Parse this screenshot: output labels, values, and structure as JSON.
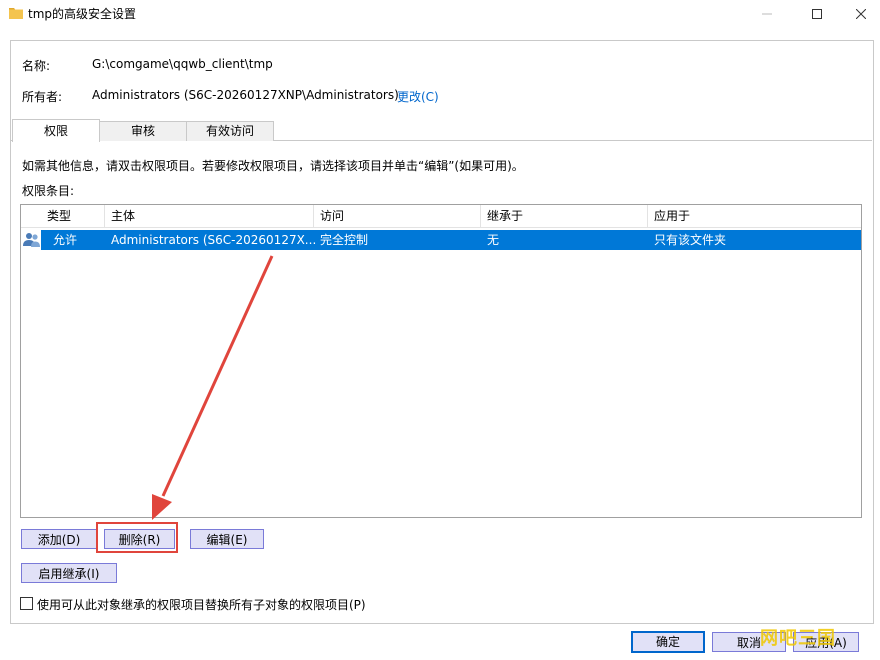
{
  "window": {
    "title": "tmp的高级安全设置",
    "minimize_icon": "minimize-icon",
    "maximize_icon": "maximize-icon",
    "close_icon": "close-icon"
  },
  "info": {
    "name_label": "名称:",
    "name_value": "G:\\comgame\\qqwb_client\\tmp",
    "owner_label": "所有者:",
    "owner_value": "Administrators (S6C-20260127XNP\\Administrators)",
    "change_link": "更改(C)"
  },
  "tabs": [
    {
      "label": "权限",
      "active": true
    },
    {
      "label": "审核",
      "active": false
    },
    {
      "label": "有效访问",
      "active": false
    }
  ],
  "hint": "如需其他信息，请双击权限项目。若要修改权限项目，请选择该项目并单击“编辑”(如果可用)。",
  "entries_label": "权限条目:",
  "table": {
    "columns": [
      "类型",
      "主体",
      "访问",
      "继承于",
      "应用于"
    ],
    "rows": [
      {
        "icon": "users-icon",
        "selected": true,
        "cells": [
          "允许",
          "Administrators (S6C-20260127X...",
          "完全控制",
          "无",
          "只有该文件夹"
        ]
      }
    ]
  },
  "buttons": {
    "add": "添加(D)",
    "remove": "删除(R)",
    "edit": "编辑(E)",
    "enable_inheritance": "启用继承(I)"
  },
  "replace_checkbox": {
    "label": "使用可从此对象继承的权限项目替换所有子对象的权限项目(P)",
    "checked": false
  },
  "footer": {
    "ok": "确定",
    "cancel": "取消",
    "apply": "应用(A)"
  },
  "watermark": "网吧三国",
  "colors": {
    "selection": "#0078d7",
    "button_border": "#7a7ad8",
    "button_bg": "#e1e1f7",
    "annotation": "#e0453c",
    "link": "#0066cc"
  }
}
